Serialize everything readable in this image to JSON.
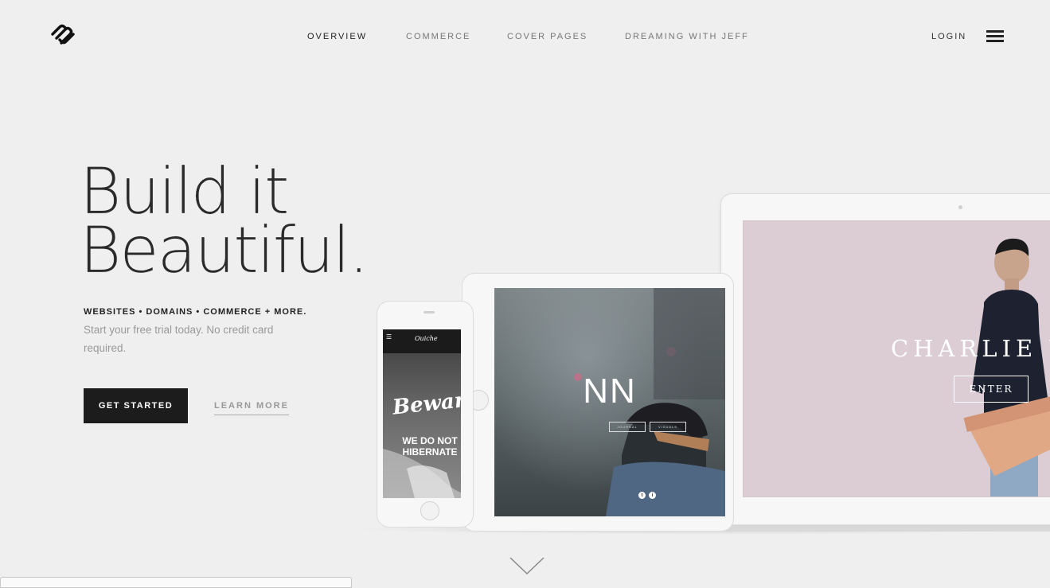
{
  "header": {
    "logo_name": "squarespace-logo",
    "nav": [
      {
        "label": "OVERVIEW",
        "active": true
      },
      {
        "label": "COMMERCE",
        "active": false
      },
      {
        "label": "COVER PAGES",
        "active": false
      },
      {
        "label": "DREAMING WITH JEFF",
        "active": false
      }
    ],
    "login": "LOGIN",
    "menu_icon": "hamburger-icon"
  },
  "hero": {
    "headline_line1": "Build it",
    "headline_line2": "Beautiful.",
    "tagline": "WEBSITES • DOMAINS • COMMERCE + MORE.",
    "subtext": "Start your free trial today. No credit card required.",
    "cta_primary": "GET STARTED",
    "cta_secondary": "LEARN MORE",
    "scroll_icon": "chevron-down-icon"
  },
  "devices": {
    "laptop": {
      "title": "CHARLIE Y",
      "button": "ENTER"
    },
    "tablet": {
      "title": "NN",
      "buttons": [
        "JOURNAL",
        "VISUALS"
      ],
      "social": [
        "t",
        "i"
      ]
    },
    "phone": {
      "logo": "Ouiche",
      "headline": "Beware",
      "subtitle_line1": "WE DO NOT",
      "subtitle_line2": "HIBERNATE"
    }
  },
  "colors": {
    "background": "#efefef",
    "primary_button": "#1c1c1c",
    "muted_text": "#999999",
    "laptop_screen": "#dccdd5"
  }
}
